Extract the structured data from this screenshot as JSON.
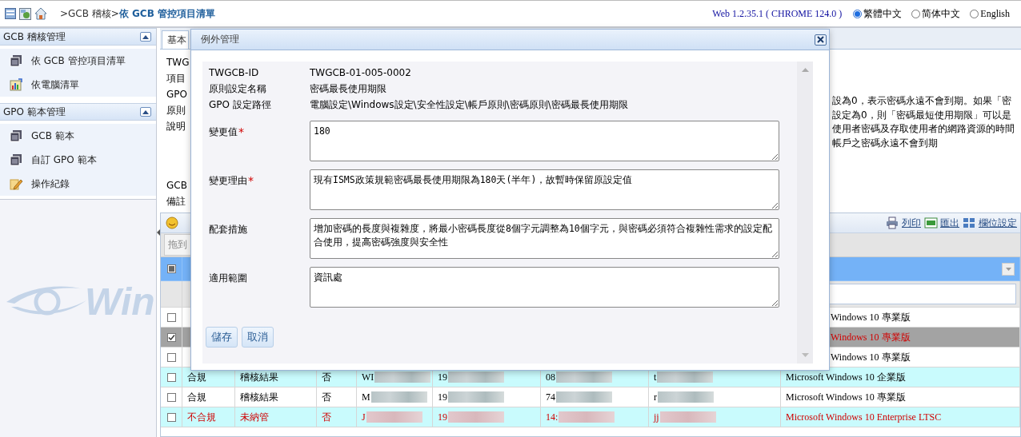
{
  "header": {
    "breadcrumb": ">GCB 稽核>**依 GCB 管控項目清單**",
    "version": "Web 1.2.35.1 ( CHROME 124.0 )",
    "languages": [
      {
        "label": "繁體中文",
        "selected": true
      },
      {
        "label": "简体中文",
        "selected": false
      },
      {
        "label": "English",
        "selected": false
      }
    ]
  },
  "sidebar": {
    "sections": [
      {
        "title": "GCB 稽核管理",
        "expanded": true,
        "items": [
          {
            "label": "依 GCB 管控項目清單",
            "kind": "window"
          },
          {
            "label": "依電腦清單",
            "kind": "chart"
          }
        ]
      },
      {
        "title": "GPO 範本管理",
        "expanded": true,
        "items": [
          {
            "label": "GCB 範本",
            "kind": "window"
          },
          {
            "label": "自訂 GPO 範本",
            "kind": "window"
          },
          {
            "label": "操作紀錄",
            "kind": "pencil"
          }
        ]
      }
    ]
  },
  "logo_text": "Win",
  "tabs": [
    {
      "label": "基本",
      "selected": true
    }
  ],
  "details": {
    "labels": [
      "TWG",
      "項目",
      "GPO",
      "原則",
      "說明",
      "GCB",
      "備註"
    ],
    "description": [
      "設為0，表示密碼永遠不會到期。如果「密",
      "設定為0，則「密碼最短使用期限」可以是",
      "使用者密碼及存取使用者的網路資源的時間",
      "帳戶之密碼永遠不會到期"
    ]
  },
  "grid": {
    "toolbar": [
      {
        "label": "列印",
        "kind": "print"
      },
      {
        "label": "匯出",
        "kind": "xls"
      },
      {
        "label": "欄位設定",
        "kind": "columns"
      }
    ],
    "group_hint": "拖到",
    "select_all": {
      "indeterminate": true
    },
    "rows": [
      {
        "checked": false,
        "selected": false,
        "highlighted": false,
        "alert": false,
        "cells": [
          "Windows 10 專業版"
        ]
      },
      {
        "checked": true,
        "selected": true,
        "highlighted": false,
        "alert": true,
        "cells": [
          "Windows 10 專業版"
        ]
      },
      {
        "checked": false,
        "selected": false,
        "highlighted": false,
        "alert": false,
        "cells": [
          "Windows 10 專業版"
        ]
      },
      {
        "checked": false,
        "selected": false,
        "highlighted": true,
        "alert": false,
        "redacted": true,
        "cells": [
          "合規",
          "稽核結果",
          "否",
          "WI",
          "19",
          "08",
          "t",
          "Microsoft Windows 10 企業版"
        ]
      },
      {
        "checked": false,
        "selected": false,
        "highlighted": false,
        "alert": false,
        "redacted": true,
        "cells": [
          "合規",
          "稽核結果",
          "否",
          "M",
          "19",
          "74",
          "r",
          "Microsoft Windows 10 專業版"
        ]
      },
      {
        "checked": false,
        "selected": false,
        "highlighted": true,
        "alert": true,
        "redacted": true,
        "cells": [
          "不合規",
          "未納管",
          "否",
          "J",
          "19",
          "14:",
          "jj",
          "Microsoft Windows 10 Enterprise LTSC"
        ]
      }
    ]
  },
  "modal": {
    "title": "例外管理",
    "info": [
      {
        "label": "TWGCB-ID",
        "value": "TWGCB-01-005-0002"
      },
      {
        "label": "原則設定名稱",
        "value": "密碼最長使用期限"
      },
      {
        "label": "GPO 設定路徑",
        "value": "電腦設定\\Windows設定\\安全性設定\\帳戶原則\\密碼原則\\密碼最長使用期限"
      }
    ],
    "fields": [
      {
        "label": "變更值",
        "required_mark": "*",
        "value": "180"
      },
      {
        "label": "變更理由",
        "required_mark": "*",
        "value": "現有ISMS政策規範密碼最長使用期限為180天(半年)，故暫時保留原設定值"
      },
      {
        "label": "配套措施",
        "value": "增加密碼的長度與複雜度，將最小密碼長度從8個字元調整為10個字元，與密碼必須符合複雜性需求的設定配合使用，提高密碼強度與安全性"
      },
      {
        "label": "適用範圍",
        "value": "資訊處"
      }
    ],
    "buttons": [
      "儲存",
      "取消"
    ]
  }
}
